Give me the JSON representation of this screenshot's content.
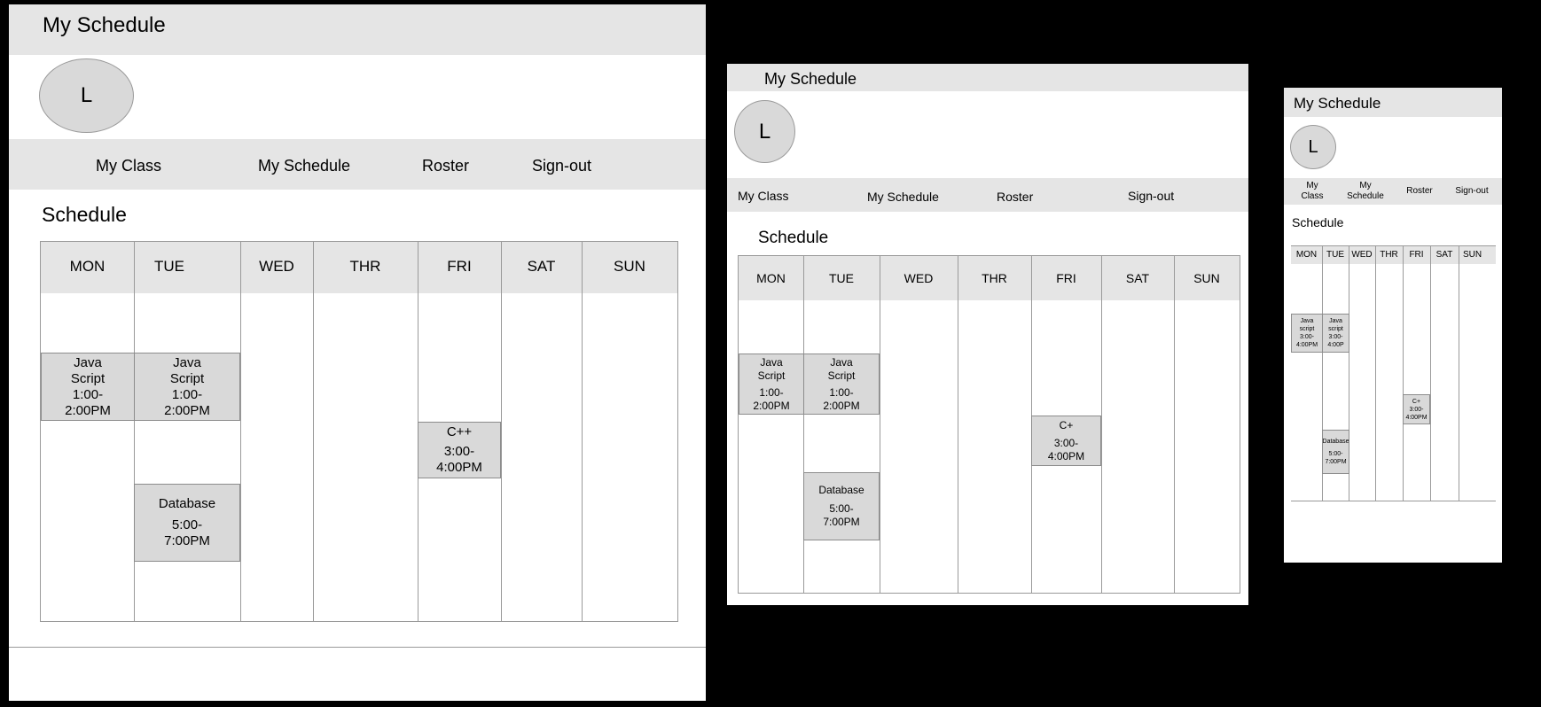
{
  "frame_large": {
    "title": "My Schedule",
    "avatar": "L",
    "nav": [
      "My Class",
      "My Schedule",
      "Roster",
      "Sign-out"
    ],
    "section": "Schedule",
    "days": [
      "MON",
      "TUE",
      "WED",
      "THR",
      "FRI",
      "SAT",
      "SUN"
    ],
    "events": {
      "mon_java": {
        "l1": "Java",
        "l2": "Script",
        "l3": "1:00-",
        "l4": "2:00PM"
      },
      "tue_java": {
        "l1": "Java",
        "l2": "Script",
        "l3": "1:00-",
        "l4": "2:00PM"
      },
      "tue_db": {
        "l1": "Database",
        "l2": "5:00-",
        "l3": "7:00PM"
      },
      "fri_cpp": {
        "l1": "C++",
        "l2": "3:00-",
        "l3": "4:00PM"
      }
    }
  },
  "frame_medium": {
    "title": "My Schedule",
    "avatar": "L",
    "nav": [
      "My Class",
      "My Schedule",
      "Roster",
      "Sign-out"
    ],
    "section": "Schedule",
    "days": [
      "MON",
      "TUE",
      "WED",
      "THR",
      "FRI",
      "SAT",
      "SUN"
    ],
    "events": {
      "mon_java": {
        "l1": "Java",
        "l2": "Script",
        "l3": "1:00-",
        "l4": "2:00PM"
      },
      "tue_java": {
        "l1": "Java",
        "l2": "Script",
        "l3": "1:00-",
        "l4": "2:00PM"
      },
      "tue_db": {
        "l1": "Database",
        "l2": "5:00-",
        "l3": "7:00PM"
      },
      "fri_cpp": {
        "l1": "C+",
        "l2": "3:00-",
        "l3": "4:00PM"
      }
    }
  },
  "frame_small": {
    "title": "My Schedule",
    "avatar": "L",
    "nav": [
      {
        "l1": "My",
        "l2": "Class"
      },
      {
        "l1": "My",
        "l2": "Schedule"
      },
      {
        "l1": "Roster",
        "l2": ""
      },
      {
        "l1": "Sign-out",
        "l2": ""
      }
    ],
    "section": "Schedule",
    "days": [
      "MON",
      "TUE",
      "WED",
      "THR",
      "FRI",
      "SAT",
      "SUN"
    ],
    "events": {
      "mon_java": {
        "l1": "Java",
        "l2": "script",
        "l3": "3:00-",
        "l4": "4:00PM"
      },
      "tue_java": {
        "l1": "Java",
        "l2": "script",
        "l3": "3:00-",
        "l4": "4:00P"
      },
      "tue_db": {
        "l1": "Database",
        "l2": "5:00-",
        "l3": "7:00PM"
      },
      "fri_cpp": {
        "l1": "C+",
        "l2": "3:00-",
        "l3": "4:00PM"
      }
    }
  },
  "colors": {
    "background": "#000000",
    "bar": "#e5e5e5",
    "event": "#d9d9d9",
    "border": "#9a9a9a"
  }
}
